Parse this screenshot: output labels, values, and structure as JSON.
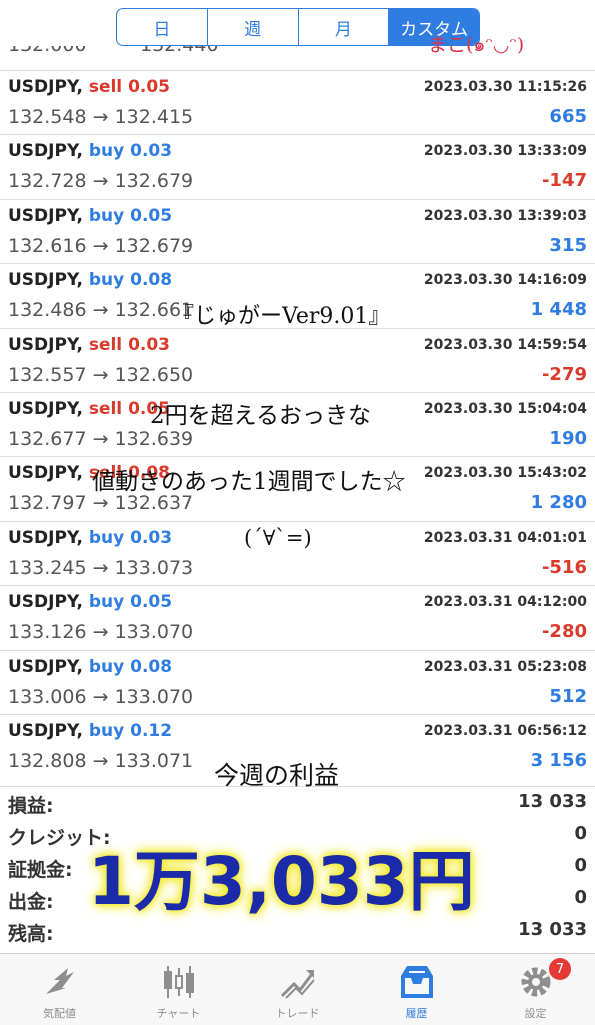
{
  "tabs_period": [
    "日",
    "週",
    "月",
    "カスタム"
  ],
  "partial_row": {
    "left": "132.000",
    "right": "132.440"
  },
  "trades": [
    {
      "symbol": "USDJPY,",
      "side": "sell",
      "lot": "0.05",
      "time": "2023.03.30 11:15:26",
      "price": "132.548 → 132.415",
      "profit": "665",
      "sign": "pos"
    },
    {
      "symbol": "USDJPY,",
      "side": "buy",
      "lot": "0.03",
      "time": "2023.03.30 13:33:09",
      "price": "132.728 → 132.679",
      "profit": "-147",
      "sign": "neg"
    },
    {
      "symbol": "USDJPY,",
      "side": "buy",
      "lot": "0.05",
      "time": "2023.03.30 13:39:03",
      "price": "132.616 → 132.679",
      "profit": "315",
      "sign": "pos"
    },
    {
      "symbol": "USDJPY,",
      "side": "buy",
      "lot": "0.08",
      "time": "2023.03.30 14:16:09",
      "price": "132.486 → 132.661",
      "profit": "1 448",
      "sign": "pos"
    },
    {
      "symbol": "USDJPY,",
      "side": "sell",
      "lot": "0.03",
      "time": "2023.03.30 14:59:54",
      "price": "132.557 → 132.650",
      "profit": "-279",
      "sign": "neg"
    },
    {
      "symbol": "USDJPY,",
      "side": "sell",
      "lot": "0.05",
      "time": "2023.03.30 15:04:04",
      "price": "132.677 → 132.639",
      "profit": "190",
      "sign": "pos"
    },
    {
      "symbol": "USDJPY,",
      "side": "sell",
      "lot": "0.08",
      "time": "2023.03.30 15:43:02",
      "price": "132.797 → 132.637",
      "profit": "1 280",
      "sign": "pos"
    },
    {
      "symbol": "USDJPY,",
      "side": "buy",
      "lot": "0.03",
      "time": "2023.03.31 04:01:01",
      "price": "133.245 → 133.073",
      "profit": "-516",
      "sign": "neg"
    },
    {
      "symbol": "USDJPY,",
      "side": "buy",
      "lot": "0.05",
      "time": "2023.03.31 04:12:00",
      "price": "133.126 → 133.070",
      "profit": "-280",
      "sign": "neg"
    },
    {
      "symbol": "USDJPY,",
      "side": "buy",
      "lot": "0.08",
      "time": "2023.03.31 05:23:08",
      "price": "133.006 → 133.070",
      "profit": "512",
      "sign": "pos"
    },
    {
      "symbol": "USDJPY,",
      "side": "buy",
      "lot": "0.12",
      "time": "2023.03.31 06:56:12",
      "price": "132.808 → 133.071",
      "profit": "3 156",
      "sign": "pos"
    }
  ],
  "summary": [
    {
      "key": "損益:",
      "value": "13 033"
    },
    {
      "key": "クレジット:",
      "value": "0"
    },
    {
      "key": "証拠金:",
      "value": "0"
    },
    {
      "key": "出金:",
      "value": "0"
    },
    {
      "key": "残高:",
      "value": "13 033"
    }
  ],
  "tabbar": [
    {
      "label": "気配値",
      "icon": "quotes-icon"
    },
    {
      "label": "チャート",
      "icon": "chart-icon"
    },
    {
      "label": "トレード",
      "icon": "trade-icon"
    },
    {
      "label": "履歴",
      "icon": "history-icon"
    },
    {
      "label": "設定",
      "icon": "settings-icon"
    }
  ],
  "settings_badge": "7",
  "overlay": {
    "author": "まこ(๑ᵔ◡ᵔ)",
    "ea_name": "『じゅがーVer9.01』",
    "line1": "2円を超えるおっきな",
    "line2": "値動きのあった1週間でした☆",
    "emote": "(´∀`=)",
    "weekly_label": "今週の利益",
    "weekly_profit": "1万3,033円"
  },
  "colors": {
    "accent": "#2f7de1",
    "loss": "#d93a2b",
    "highlight": "#f3ea31"
  }
}
